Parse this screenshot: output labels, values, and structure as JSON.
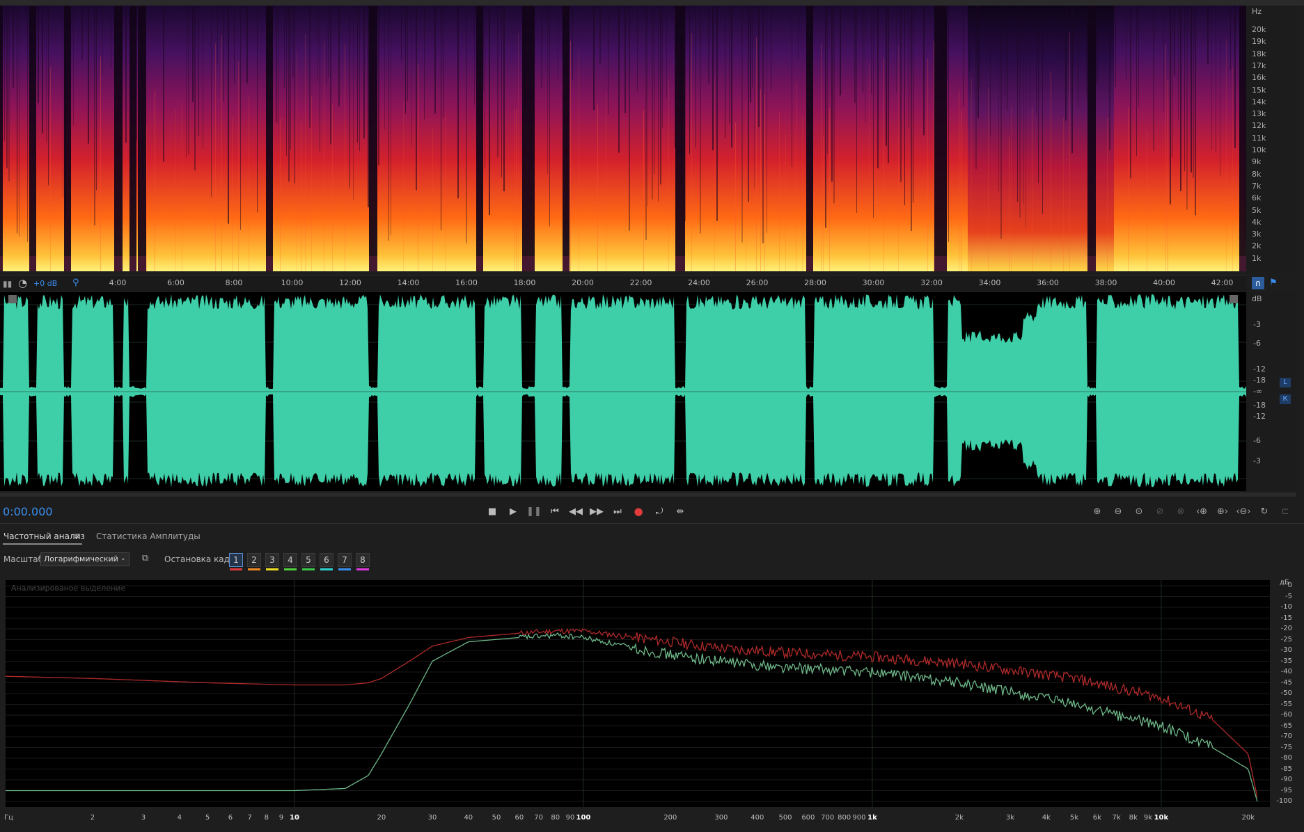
{
  "spectral": {
    "unit": "Hz",
    "freq_labels": [
      "20k",
      "19k",
      "18k",
      "17k",
      "16k",
      "15k",
      "14k",
      "13k",
      "12k",
      "11k",
      "10k",
      "9k",
      "8k",
      "7k",
      "6k",
      "5k",
      "4k",
      "3k",
      "2k",
      "1k"
    ]
  },
  "timeline": {
    "gain_label": "+0 dB",
    "ticks": [
      "4:00",
      "6:00",
      "8:00",
      "10:00",
      "12:00",
      "14:00",
      "16:00",
      "18:00",
      "20:00",
      "22:00",
      "24:00",
      "26:00",
      "28:00",
      "30:00",
      "32:00",
      "34:00",
      "36:00",
      "38:00",
      "40:00",
      "42:00"
    ]
  },
  "waveform": {
    "unit": "dB",
    "db_labels": [
      "-3",
      "-6",
      "-12",
      "-18",
      "-∞",
      "-18",
      "-12",
      "-6",
      "-3"
    ],
    "channel_L": "L",
    "channel_R": "К",
    "color": "#3fcfa8"
  },
  "transport": {
    "time": "0:00.000",
    "time_color": "#3b8ef0"
  },
  "analysis": {
    "tab_frequency": "Частотный анализ",
    "tab_amplitude": "Статистика Амплитуды",
    "scale_label": "Масштаб:",
    "scale_value": "Логарифмический",
    "hold_label": "Остановка кадра:",
    "hold_buttons": [
      "1",
      "2",
      "3",
      "4",
      "5",
      "6",
      "7",
      "8"
    ],
    "hold_colors": [
      "#e23b3b",
      "#f08a24",
      "#f0e024",
      "#4fd23c",
      "#39c84a",
      "#2fd2d2",
      "#3a8ef0",
      "#e03ae0"
    ],
    "panel_caption": "Анализированое выделение",
    "y_unit": "дБ",
    "y_labels": [
      "0",
      "-5",
      "-10",
      "-15",
      "-20",
      "-25",
      "-30",
      "-35",
      "-40",
      "-45",
      "-50",
      "-55",
      "-60",
      "-65",
      "-70",
      "-75",
      "-80",
      "-85",
      "-90",
      "-95",
      "-100"
    ],
    "x_unit": "Гц",
    "x_labels": [
      "2",
      "3",
      "4",
      "5",
      "6",
      "7",
      "8",
      "9",
      "10",
      "20",
      "30",
      "40",
      "50",
      "60",
      "70",
      "80",
      "90",
      "100",
      "200",
      "300",
      "400",
      "500",
      "600",
      "700",
      "800",
      "900",
      "1k",
      "2k",
      "3k",
      "4k",
      "5k",
      "6k",
      "7k",
      "8k",
      "9k",
      "10k",
      "20k"
    ]
  },
  "chart_data": {
    "type": "line",
    "x_scale": "log",
    "xlim": [
      1,
      22000
    ],
    "ylim": [
      -100,
      0
    ],
    "x": [
      1,
      2,
      5,
      10,
      15,
      18,
      20,
      25,
      30,
      40,
      60,
      80,
      100,
      150,
      200,
      300,
      500,
      1000,
      2000,
      5000,
      10000,
      15000,
      20000,
      21500
    ],
    "series": [
      {
        "color": "#b12a2a",
        "values": [
          -42,
          -43,
          -45,
          -46,
          -46,
          -45,
          -43,
          -35,
          -28,
          -24,
          -22,
          -21,
          -21,
          -24,
          -26,
          -29,
          -31,
          -33,
          -36,
          -43,
          -52,
          -62,
          -78,
          -98
        ]
      },
      {
        "color": "#6fb98a",
        "values": [
          -95,
          -95,
          -95,
          -95,
          -94,
          -88,
          -78,
          -55,
          -35,
          -26,
          -24,
          -23,
          -24,
          -29,
          -32,
          -35,
          -38,
          -40,
          -45,
          -55,
          -65,
          -75,
          -85,
          -100
        ]
      }
    ]
  }
}
